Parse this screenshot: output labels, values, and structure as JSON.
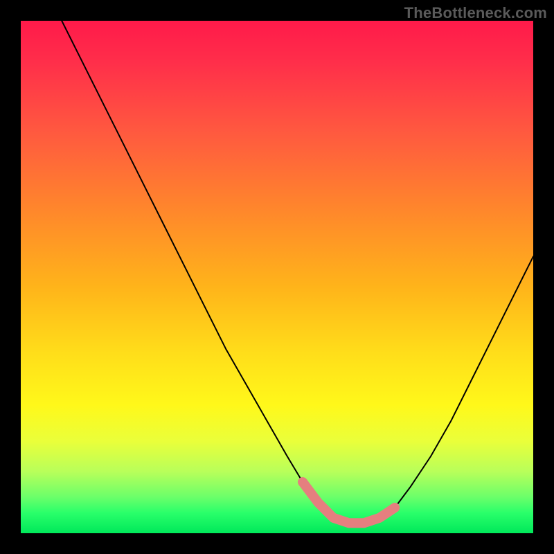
{
  "watermark": "TheBottleneck.com",
  "chart_data": {
    "type": "line",
    "title": "",
    "xlabel": "",
    "ylabel": "",
    "xlim": [
      0,
      100
    ],
    "ylim": [
      0,
      100
    ],
    "series": [
      {
        "name": "bottleneck-curve",
        "x": [
          8,
          12,
          16,
          20,
          24,
          28,
          32,
          36,
          40,
          44,
          48,
          52,
          55,
          58,
          61,
          64,
          67,
          70,
          73,
          76,
          80,
          84,
          88,
          92,
          96,
          100
        ],
        "y": [
          100,
          92,
          84,
          76,
          68,
          60,
          52,
          44,
          36,
          29,
          22,
          15,
          10,
          6,
          3,
          2,
          2,
          3,
          5,
          9,
          15,
          22,
          30,
          38,
          46,
          54
        ]
      }
    ],
    "highlight_region": {
      "name": "optimal-band",
      "x": [
        55,
        73
      ],
      "y": [
        2,
        6
      ]
    },
    "background_gradient_meaning": "red_high_bottleneck_to_green_no_bottleneck"
  }
}
